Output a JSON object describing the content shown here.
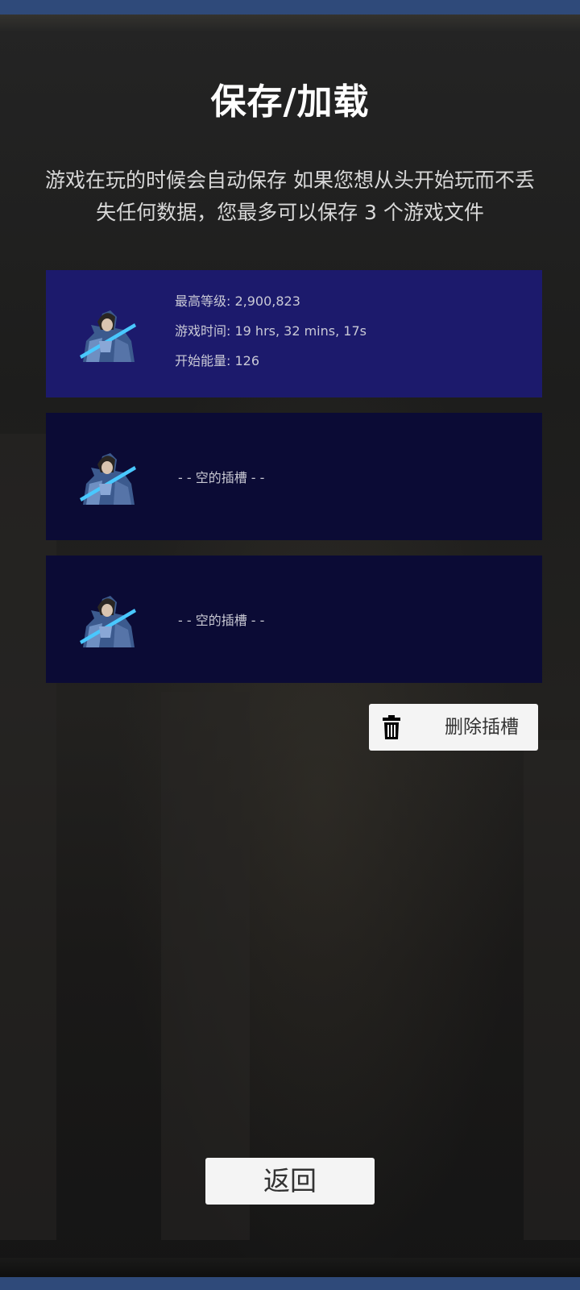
{
  "page": {
    "title": "保存/加载",
    "description": "游戏在玩的时候会自动保存 如果您想从头开始玩而不丢失任何数据，您最多可以保存 3 个游戏文件"
  },
  "slots": [
    {
      "state": "filled",
      "avatar_icon": "knight-portrait-icon",
      "lines": [
        "最高等级: 2,900,823",
        "游戏时间: 19 hrs, 32 mins, 17s",
        "开始能量: 126"
      ]
    },
    {
      "state": "empty",
      "avatar_icon": "knight-portrait-icon",
      "label": "- - 空的插槽 - -"
    },
    {
      "state": "empty",
      "avatar_icon": "knight-portrait-icon",
      "label": "- - 空的插槽 - -"
    }
  ],
  "actions": {
    "delete_label": "删除插槽",
    "delete_icon": "trash-icon",
    "back_label": "返回"
  },
  "colors": {
    "filled_slot": "#1c1a6c",
    "empty_slot": "#0b0b35",
    "status_bar": "#2f4a7a",
    "button_bg": "#f4f4f4"
  }
}
